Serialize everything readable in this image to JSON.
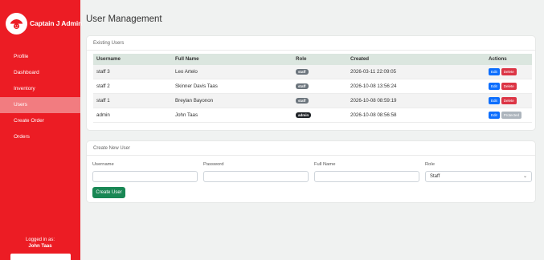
{
  "sidebar": {
    "brand": "Captain J Admin",
    "nav": [
      {
        "label": "Profile"
      },
      {
        "label": "Dashboard"
      },
      {
        "label": "Inventory"
      },
      {
        "label": "Users",
        "active": true
      },
      {
        "label": "Create Order"
      },
      {
        "label": "Orders"
      }
    ],
    "logged_in_label": "Logged in as:",
    "logged_in_user": "John Taas"
  },
  "page": {
    "title": "User Management"
  },
  "existing_users": {
    "header": "Existing Users",
    "columns": [
      "Username",
      "Full Name",
      "Role",
      "Created",
      "Actions"
    ],
    "rows": [
      {
        "username": "staff 3",
        "full_name": "Leo Artelo",
        "role": "staff",
        "created": "2026-03-11 22:09:05",
        "actions": [
          "Edit",
          "Delete"
        ]
      },
      {
        "username": "staff 2",
        "full_name": "Skinner Davis Taas",
        "role": "staff",
        "created": "2026-10-08 13:56:24",
        "actions": [
          "Edit",
          "Delete"
        ]
      },
      {
        "username": "staff 1",
        "full_name": "Breylan Bayonon",
        "role": "staff",
        "created": "2026-10-08 08:59:19",
        "actions": [
          "Edit",
          "Delete"
        ]
      },
      {
        "username": "admin",
        "full_name": "John Taas",
        "role": "admin",
        "created": "2026-10-08 08:56:58",
        "actions": [
          "Edit",
          "Protected"
        ]
      }
    ]
  },
  "create_user": {
    "header": "Create New User",
    "username_label": "Username",
    "password_label": "Password",
    "fullname_label": "Full Name",
    "role_label": "Role",
    "username_value": "",
    "password_value": "",
    "fullname_value": "",
    "role_value": "Staff",
    "submit_label": "Create User"
  },
  "colors": {
    "sidebar": "#ec1c24",
    "active_nav": "#f27c80",
    "edit": "#0d6efd",
    "delete": "#dc3545",
    "create": "#198754"
  }
}
